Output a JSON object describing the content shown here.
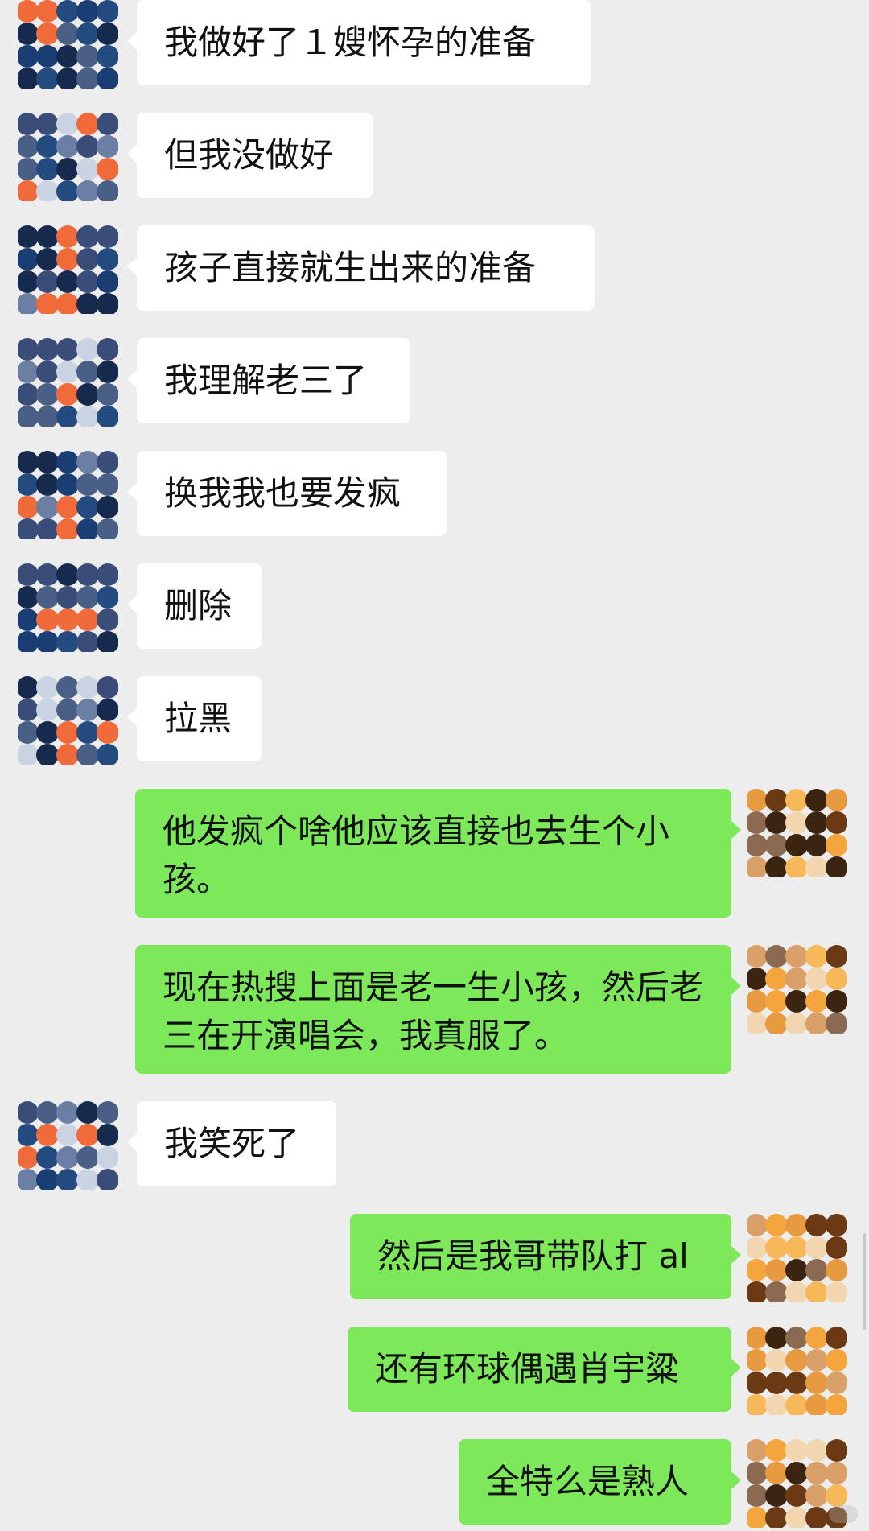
{
  "colors": {
    "background": "#ededed",
    "incoming_bubble": "#ffffff",
    "outgoing_bubble": "#7de85a",
    "incoming_avatar_palette": [
      "#1a3e74",
      "#244b80",
      "#3a4d78",
      "#4a5f86",
      "#6b7ea4",
      "#f06a3a",
      "#162a4e",
      "#c9d3e2"
    ],
    "outgoing_avatar_palette": [
      "#f4a53e",
      "#f7b85a",
      "#e89a40",
      "#6b3a14",
      "#3b2510",
      "#f2d6b0",
      "#d9a06a",
      "#8c6a52"
    ]
  },
  "messages": [
    {
      "side": "left",
      "text": "我做好了１嫂怀孕的准备",
      "avatar": "contact-avatar"
    },
    {
      "side": "left",
      "text": "但我没做好",
      "avatar": "contact-avatar"
    },
    {
      "side": "left",
      "text": "孩子直接就生出来的准备",
      "avatar": "contact-avatar"
    },
    {
      "side": "left",
      "text": "我理解老三了",
      "avatar": "contact-avatar"
    },
    {
      "side": "left",
      "text": "换我我也要发疯",
      "avatar": "contact-avatar"
    },
    {
      "side": "left",
      "text": "删除",
      "avatar": "contact-avatar"
    },
    {
      "side": "left",
      "text": "拉黑",
      "avatar": "contact-avatar"
    },
    {
      "side": "right",
      "text": "他发疯个啥他应该直接也去生个小孩。",
      "avatar": "self-avatar"
    },
    {
      "side": "right",
      "text": "现在热搜上面是老一生小孩，然后老三在开演唱会，我真服了。",
      "avatar": "self-avatar"
    },
    {
      "side": "left",
      "text": "我笑死了",
      "avatar": "contact-avatar"
    },
    {
      "side": "right",
      "text": "然后是我哥带队打 al",
      "avatar": "self-avatar"
    },
    {
      "side": "right",
      "text": "还有环球偶遇肖宇粱",
      "avatar": "self-avatar"
    },
    {
      "side": "right",
      "text": "全特么是熟人",
      "avatar": "self-avatar"
    }
  ]
}
